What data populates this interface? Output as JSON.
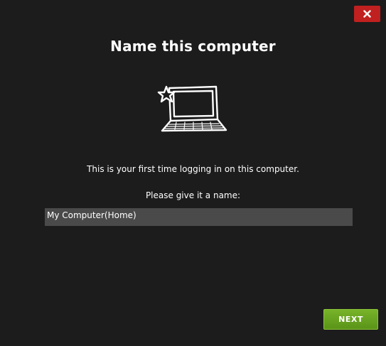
{
  "dialog": {
    "title": "Name this computer",
    "close_icon": "close-icon",
    "illustration_icon": "laptop-icon",
    "message_line1": "This is your first time logging in on this computer.",
    "message_line2": "Please give it a name:",
    "computer_name_value": "My Computer(Home)",
    "next_label": "NEXT"
  },
  "colors": {
    "background": "#1c1c1c",
    "close_button": "#c0201f",
    "input_background": "#4a4a4a",
    "next_button": "#6aa620"
  }
}
